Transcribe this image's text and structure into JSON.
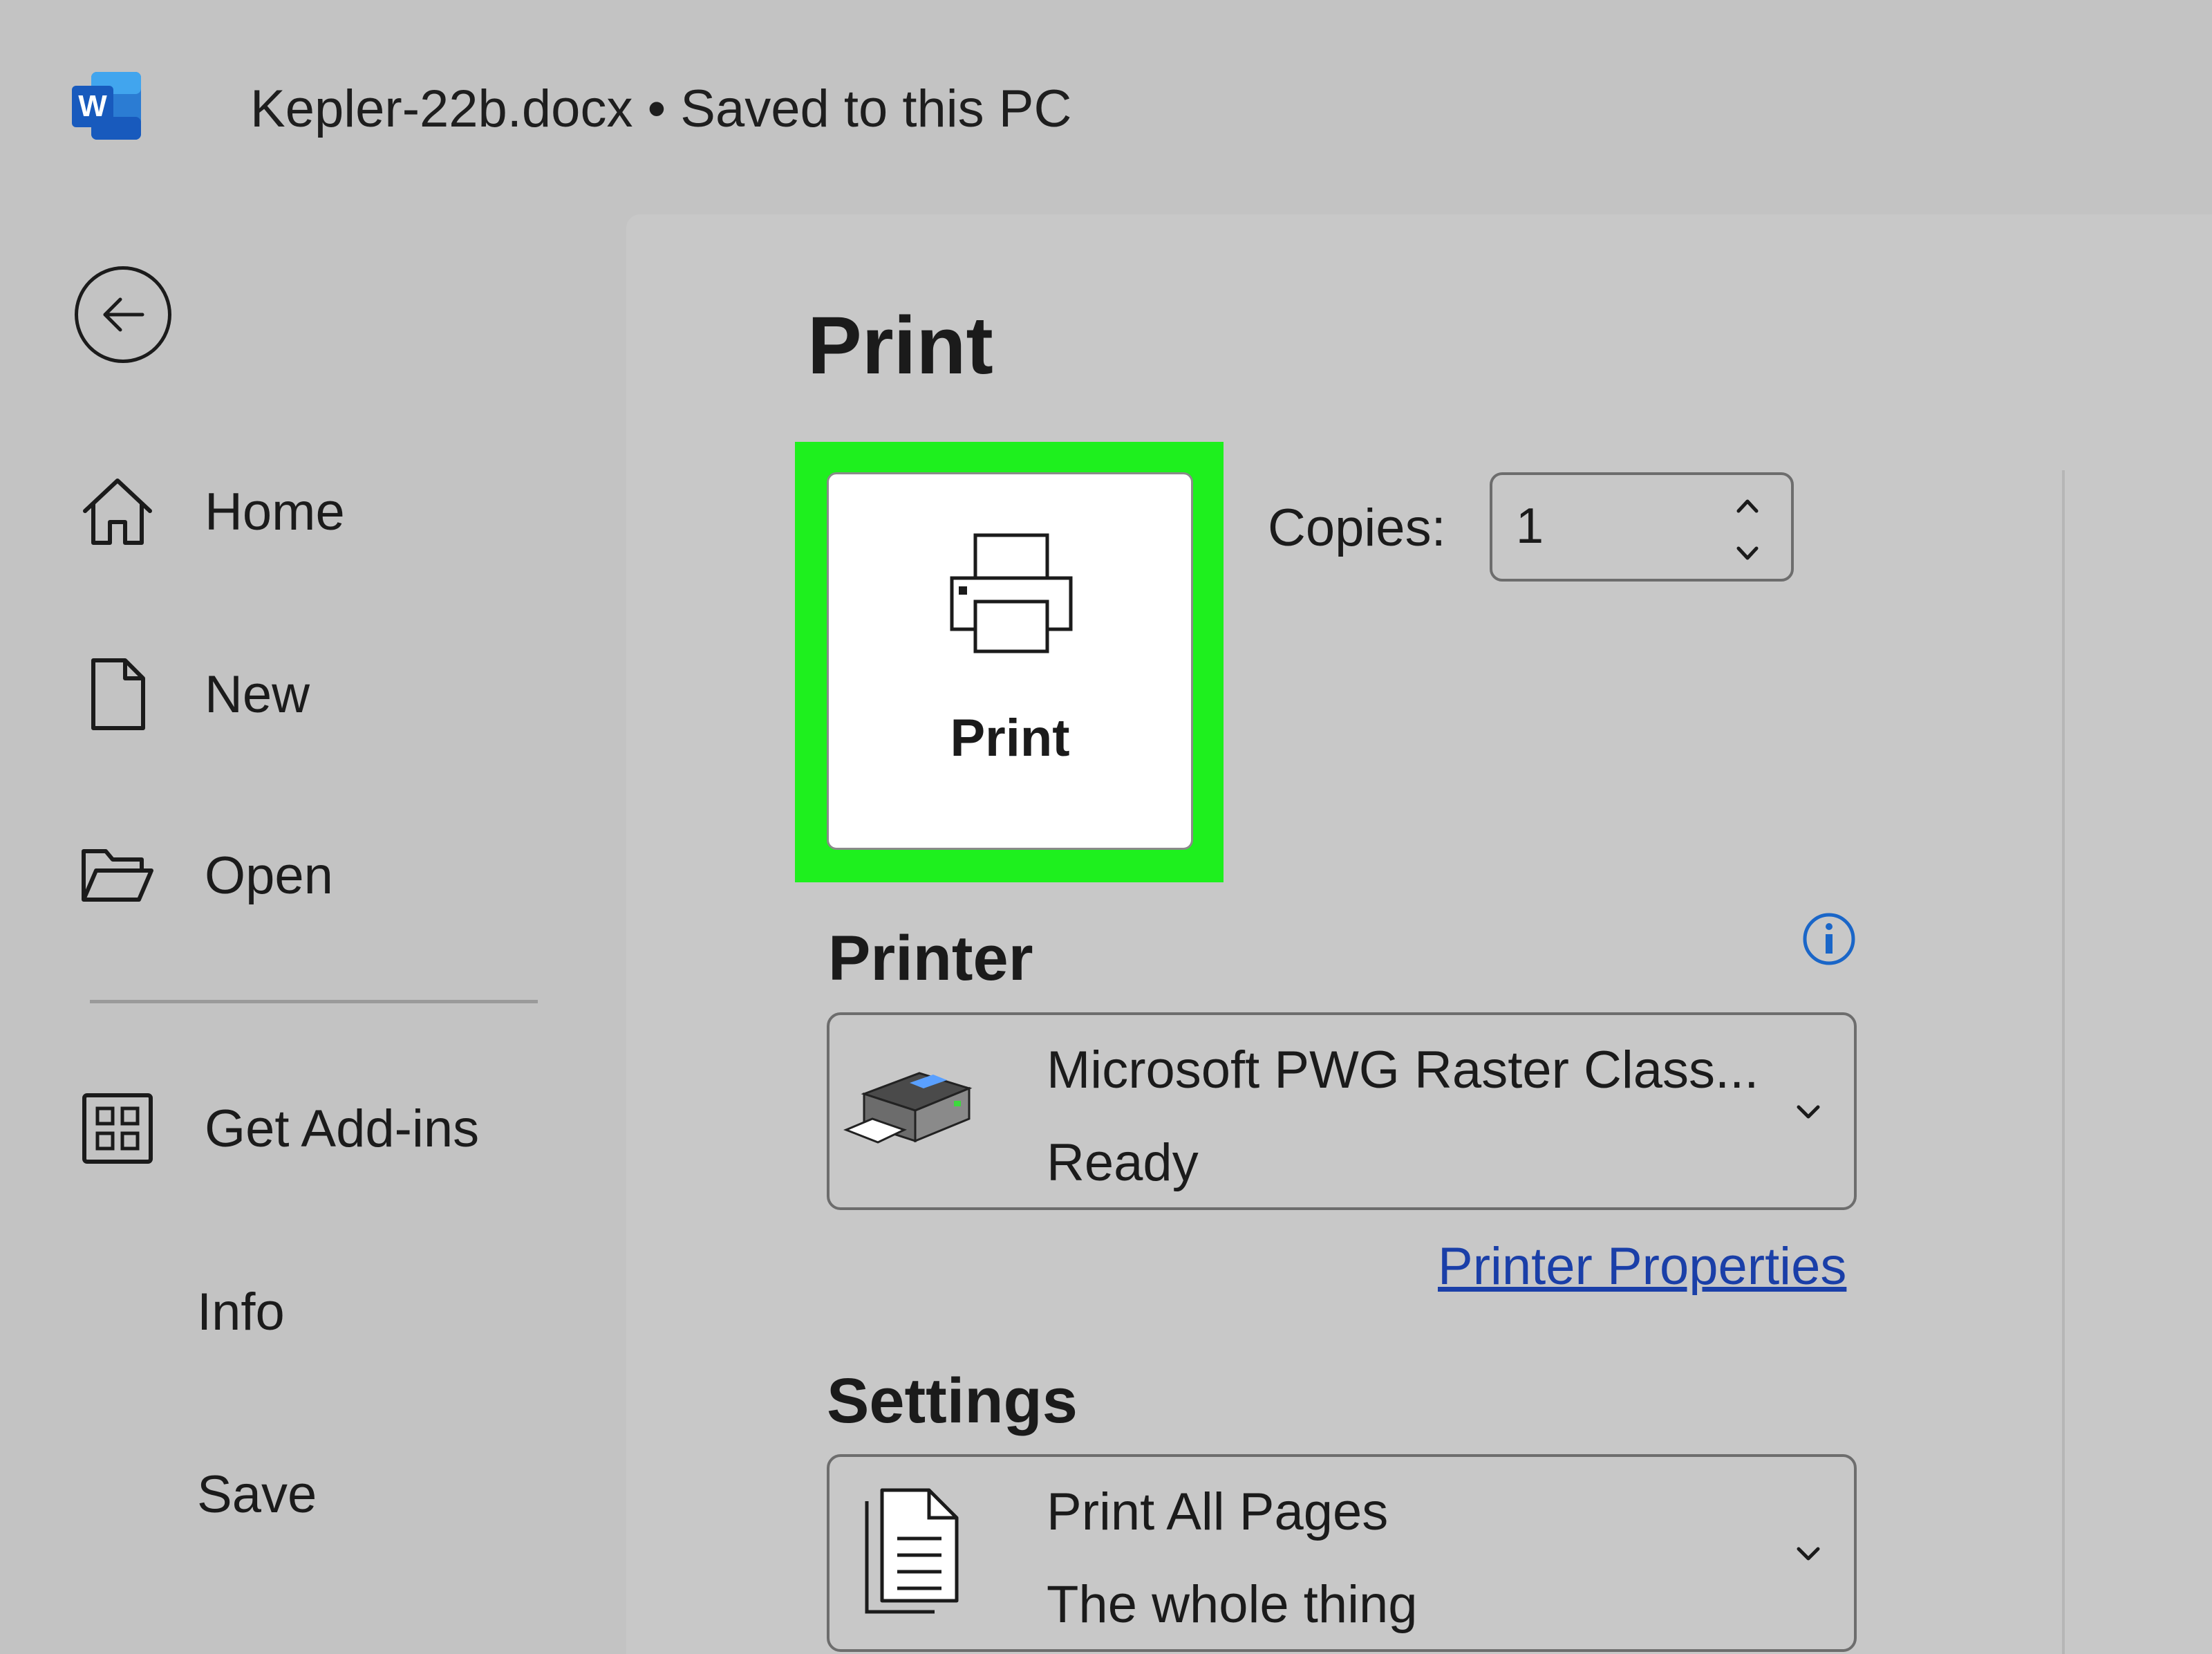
{
  "window": {
    "title": "Kepler-22b.docx • Saved to this PC"
  },
  "nav": {
    "back_icon": "back-arrow-icon",
    "items": [
      {
        "label": "Home",
        "icon": "home-icon"
      },
      {
        "label": "New",
        "icon": "new-document-icon"
      },
      {
        "label": "Open",
        "icon": "open-folder-icon"
      },
      {
        "label": "Get Add-ins",
        "icon": "add-ins-grid-icon"
      },
      {
        "label": "Info"
      },
      {
        "label": "Save"
      }
    ]
  },
  "print": {
    "title": "Print",
    "button_label": "Print",
    "copies_label": "Copies:",
    "copies_value": "1",
    "highlight_color": "#1ef01e"
  },
  "printer": {
    "section_label": "Printer",
    "name": "Microsoft PWG Raster Class...",
    "status": "Ready",
    "properties_link": "Printer Properties"
  },
  "settings": {
    "section_label": "Settings",
    "option": "Print All Pages",
    "description": "The whole thing"
  }
}
